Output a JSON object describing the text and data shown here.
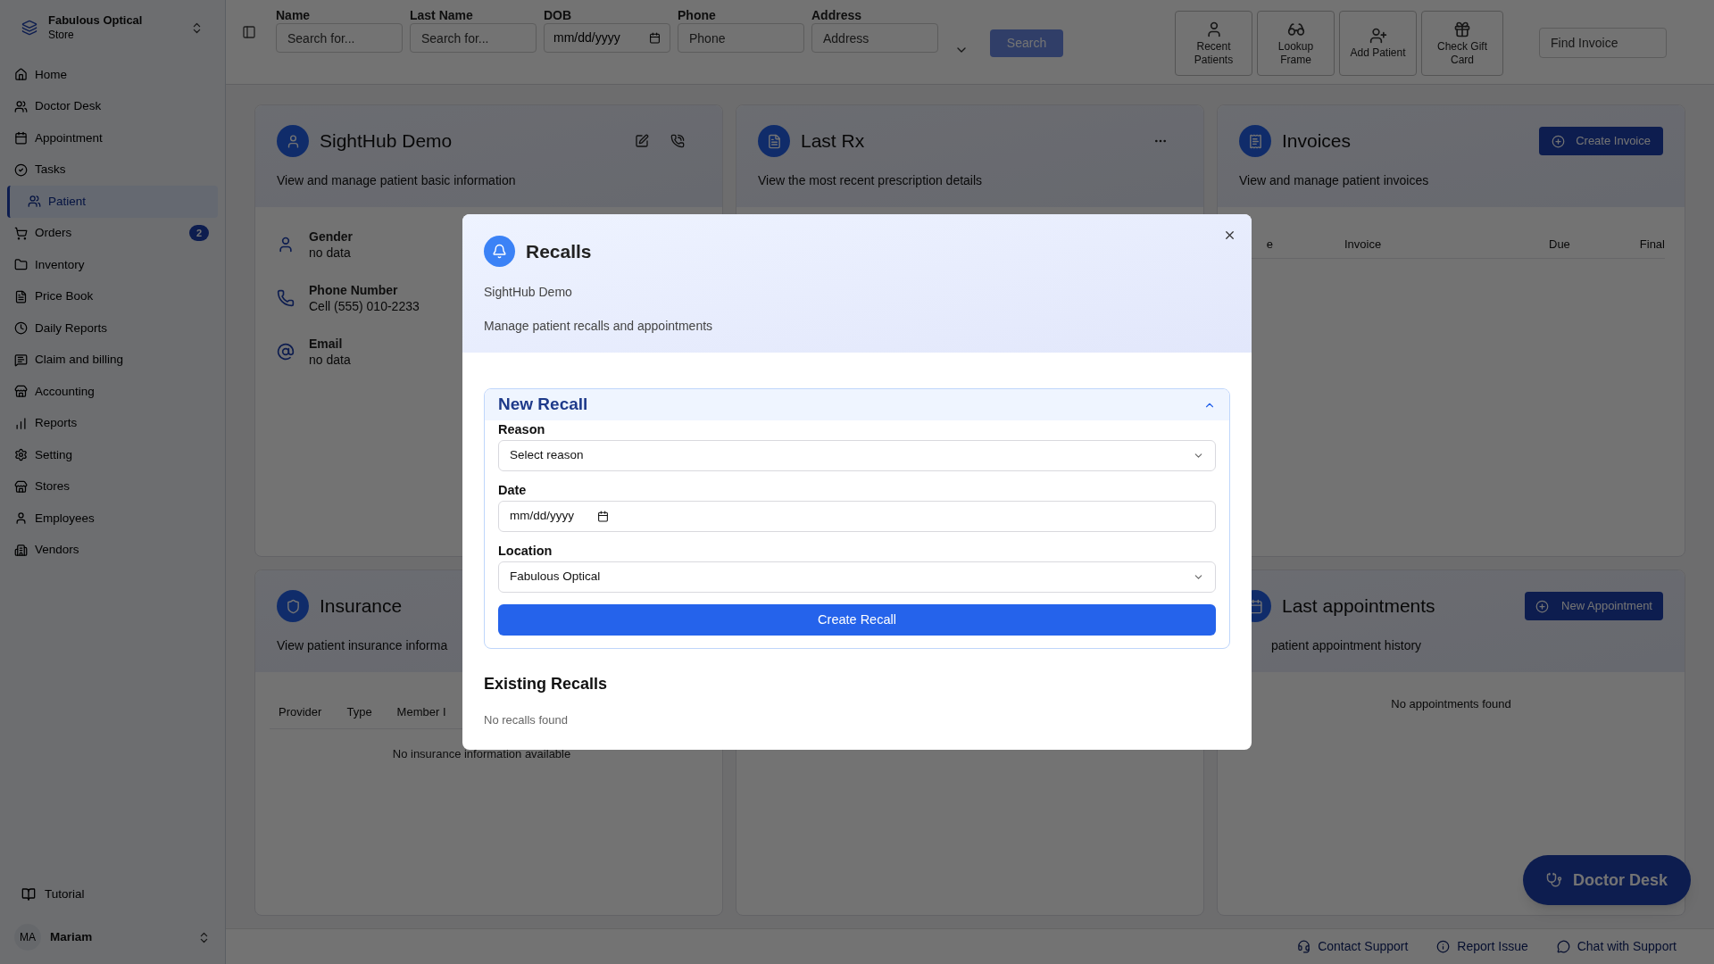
{
  "sidebar": {
    "store_name": "Fabulous Optical",
    "store_type": "Store",
    "items": [
      {
        "label": "Home",
        "selected": false
      },
      {
        "label": "Doctor Desk",
        "selected": false
      },
      {
        "label": "Appointment",
        "selected": false
      },
      {
        "label": "Tasks",
        "selected": false
      },
      {
        "label": "Patient",
        "selected": true
      },
      {
        "label": "Orders",
        "selected": false,
        "badge": "2"
      },
      {
        "label": "Inventory",
        "selected": false
      },
      {
        "label": "Price Book",
        "selected": false
      },
      {
        "label": "Daily Reports",
        "selected": false
      },
      {
        "label": "Claim and billing",
        "selected": false
      },
      {
        "label": "Accounting",
        "selected": false
      },
      {
        "label": "Reports",
        "selected": false
      },
      {
        "label": "Setting",
        "selected": false
      },
      {
        "label": "Stores",
        "selected": false
      },
      {
        "label": "Employees",
        "selected": false
      },
      {
        "label": "Vendors",
        "selected": false
      }
    ],
    "tutorial": "Tutorial",
    "user": {
      "initials": "MA",
      "name": "Mariam"
    }
  },
  "search_bar": {
    "fields": [
      {
        "kind": "text",
        "label": "Name",
        "placeholder": "Search for..."
      },
      {
        "kind": "text",
        "label": "Last Name",
        "placeholder": "Search for..."
      },
      {
        "kind": "date",
        "label": "DOB",
        "value": "mm/dd/yyyy"
      },
      {
        "kind": "text",
        "label": "Phone",
        "placeholder": "Phone"
      },
      {
        "kind": "text",
        "label": "Address",
        "placeholder": "Address"
      }
    ],
    "search_button": "Search"
  },
  "quick_actions": [
    {
      "label": "Recent Patients"
    },
    {
      "label": "Lookup Frame"
    },
    {
      "label": "Add Patient"
    },
    {
      "label": "Check Gift Card"
    }
  ],
  "find_invoice": {
    "placeholder": "Find Invoice"
  },
  "patient_card": {
    "title": "SightHub Demo",
    "description": "View and manage patient basic information",
    "fields": [
      {
        "label": "Gender",
        "value": "no data"
      },
      {
        "label": "Phone Number",
        "value": "Cell (555) 010-2233"
      },
      {
        "label": "Email",
        "value": "no data"
      }
    ]
  },
  "last_rx_card": {
    "title": "Last Rx",
    "description": "View the most recent prescription details"
  },
  "invoices_card": {
    "title": "Invoices",
    "description": "View and manage patient invoices",
    "button": "Create Invoice",
    "columns": [
      "e",
      "Invoice",
      "Due",
      "Final"
    ]
  },
  "insurance_card": {
    "title": "Insurance",
    "description": "View patient insurance informa",
    "columns": [
      "Provider",
      "Type",
      "Member I"
    ],
    "empty": "No insurance information available"
  },
  "appointments_card": {
    "title": "Last appointments",
    "description": "patient appointment history",
    "button": "New Appointment",
    "empty": "No appointments found"
  },
  "modal": {
    "title": "Recalls",
    "subtitle": "SightHub Demo",
    "description": "Manage patient recalls and appointments",
    "section": {
      "title": "New Recall",
      "expanded": true,
      "reason": {
        "label": "Reason",
        "value": "Select reason"
      },
      "date": {
        "label": "Date",
        "value": "mm/dd/yyyy"
      },
      "location": {
        "label": "Location",
        "value": "Fabulous Optical"
      },
      "submit": "Create Recall"
    },
    "existing_title": "Existing Recalls",
    "existing_empty": "No recalls found"
  },
  "floating_button": "Doctor Desk",
  "footer_links": [
    "Contact Support",
    "Report Issue",
    "Chat with Support"
  ]
}
